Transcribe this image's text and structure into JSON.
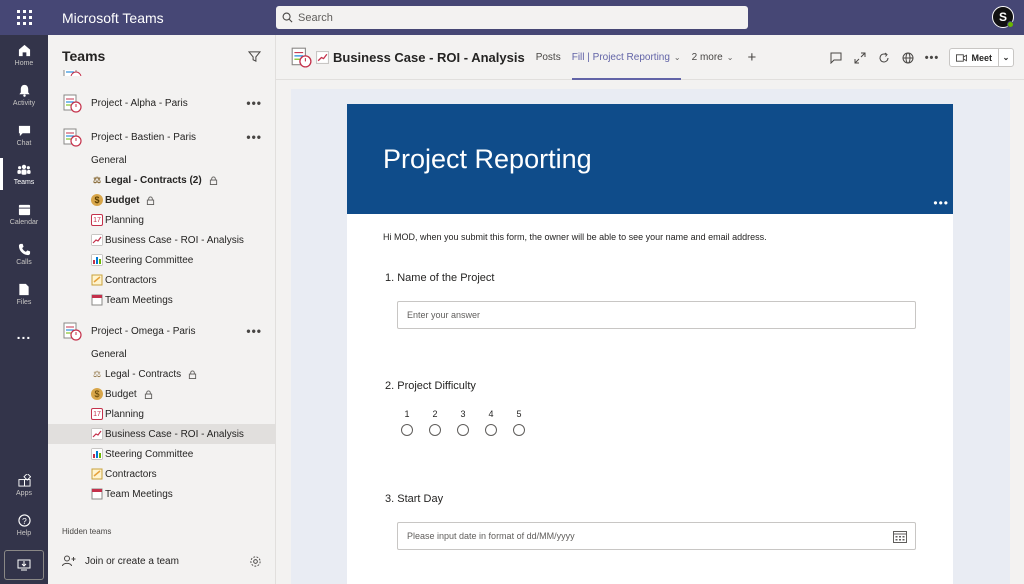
{
  "app": {
    "title": "Microsoft Teams",
    "search_placeholder": "Search",
    "avatar_initial": "S"
  },
  "rail": [
    {
      "label": "Home",
      "icon": "home-icon"
    },
    {
      "label": "Activity",
      "icon": "bell-icon"
    },
    {
      "label": "Chat",
      "icon": "chat-icon"
    },
    {
      "label": "Teams",
      "icon": "teams-icon"
    },
    {
      "label": "Calendar",
      "icon": "calendar-icon"
    },
    {
      "label": "Calls",
      "icon": "phone-icon"
    },
    {
      "label": "Files",
      "icon": "file-icon"
    },
    {
      "label": "...",
      "icon": "more-icon"
    },
    {
      "label": "Apps",
      "icon": "apps-icon"
    },
    {
      "label": "Help",
      "icon": "help-icon"
    }
  ],
  "sidebar": {
    "title": "Teams",
    "teams": [
      {
        "name": "Project - Alpha - Paris"
      },
      {
        "name": "Project - Bastien - Paris",
        "channels": [
          {
            "label": "General"
          },
          {
            "label": "Legal - Contracts (2)",
            "icon": "scales-icon",
            "locked": true,
            "bold": true
          },
          {
            "label": "Budget",
            "icon": "money-bag-icon",
            "locked": true,
            "bold": true
          },
          {
            "label": "Planning",
            "icon": "calendar-icon"
          },
          {
            "label": "Business Case - ROI - Analysis",
            "icon": "chart-up-icon"
          },
          {
            "label": "Steering Committee",
            "icon": "bar-chart-icon"
          },
          {
            "label": "Contractors",
            "icon": "memo-icon"
          },
          {
            "label": "Team Meetings",
            "icon": "tear-calendar-icon"
          }
        ]
      },
      {
        "name": "Project - Omega - Paris",
        "channels": [
          {
            "label": "General"
          },
          {
            "label": "Legal - Contracts",
            "icon": "scales-icon",
            "locked": true
          },
          {
            "label": "Budget",
            "icon": "money-bag-icon",
            "locked": true
          },
          {
            "label": "Planning",
            "icon": "calendar-icon"
          },
          {
            "label": "Business Case - ROI - Analysis",
            "icon": "chart-up-icon",
            "active": true
          },
          {
            "label": "Steering Committee",
            "icon": "bar-chart-icon"
          },
          {
            "label": "Contractors",
            "icon": "memo-icon"
          },
          {
            "label": "Team Meetings",
            "icon": "tear-calendar-icon"
          }
        ]
      }
    ],
    "hidden_teams": "Hidden teams",
    "join_label": "Join or create a team"
  },
  "channel": {
    "title": "Business Case - ROI - Analysis",
    "tabs": [
      "Posts",
      "Fill | Project Reporting",
      "2 more"
    ],
    "active_tab": "Fill | Project Reporting",
    "meet_label": "Meet"
  },
  "form": {
    "title": "Project Reporting",
    "notice": "Hi MOD, when you submit this form, the owner will be able to see your name and email address.",
    "questions": [
      {
        "label": "1. Name of the Project",
        "placeholder": "Enter your answer"
      },
      {
        "label": "2. Project Difficulty",
        "scale": [
          "1",
          "2",
          "3",
          "4",
          "5"
        ]
      },
      {
        "label": "3. Start Day",
        "placeholder": "Please input date in format of dd/MM/yyyy"
      }
    ]
  },
  "colors": {
    "header": "#464775",
    "rail": "#33344a",
    "accent": "#6264a7",
    "banner": "#0f4c8a"
  }
}
